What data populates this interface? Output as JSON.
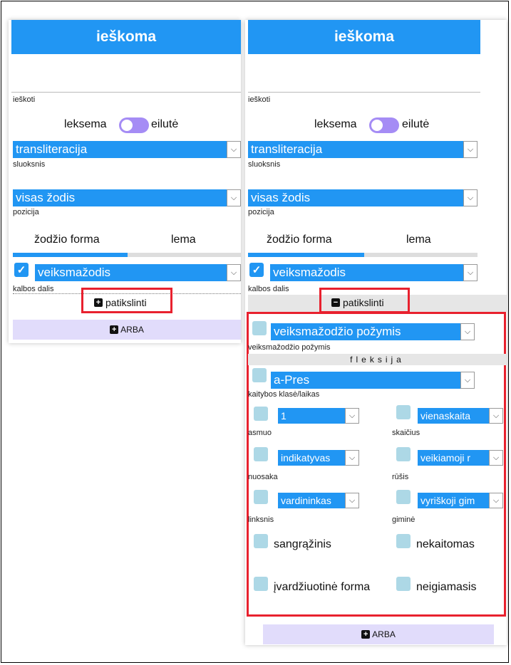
{
  "panel1": {
    "header": "ieškoma",
    "search_label": "ieškoti",
    "toggle_left": "leksema",
    "toggle_right": "eilutė",
    "layer_select": "transliteracija",
    "layer_label": "sluoksnis",
    "position_select": "visas žodis",
    "position_label": "pozicija",
    "tab_wordform": "žodžio forma",
    "tab_lemma": "lema",
    "pos_select": "veiksmažodis",
    "pos_label": "kalbos dalis",
    "refine_button": "patikslinti",
    "or_button": "ARBA"
  },
  "panel2": {
    "header": "ieškoma",
    "search_label": "ieškoti",
    "toggle_left": "leksema",
    "toggle_right": "eilutė",
    "layer_select": "transliteracija",
    "layer_label": "sluoksnis",
    "position_select": "visas žodis",
    "position_label": "pozicija",
    "tab_wordform": "žodžio forma",
    "tab_lemma": "lema",
    "pos_select": "veiksmažodis",
    "pos_label": "kalbos dalis",
    "refine_button": "patikslinti",
    "adverb_feature_select": "veiksmažodžio požymis",
    "adverb_feature_label": "veiksmažodžio požymis",
    "flexion_title": "fleksija",
    "class_select": "a-Pres",
    "class_label": "kaitybos klasė/laikas",
    "person_select": "1",
    "person_label": "asmuo",
    "number_select": "vienaskaita",
    "number_label": "skaičius",
    "mood_select": "indikatyvas",
    "mood_label": "nuosaka",
    "voice_select": "veikiamoji r",
    "voice_label": "rūšis",
    "case_select": "vardininkas",
    "case_label": "linksnis",
    "gender_select": "vyriškoji gim",
    "gender_label": "giminė",
    "reflexive": "sangrąžinis",
    "invariable": "nekaitomas",
    "pronominal": "įvardžiuotinė forma",
    "negative": "neigiamasis",
    "or_button": "ARBA"
  },
  "colors": {
    "accent": "#2196f3",
    "highlight": "#e8212e",
    "toggle": "#a58cf5",
    "checkbox": "#add8e6"
  },
  "icons": {
    "plus": "plus-square-icon",
    "minus": "minus-square-icon",
    "check": "check-icon",
    "chevron": "chevron-down-icon"
  }
}
